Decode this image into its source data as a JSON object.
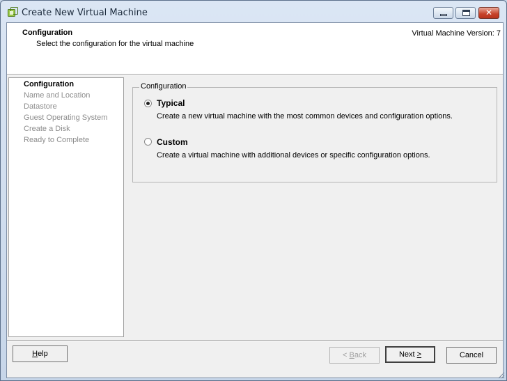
{
  "window": {
    "title": "Create New Virtual Machine",
    "app_icon": "vsphere-vm-icon",
    "controls": {
      "minimize": "minimize-icon",
      "maximize": "maximize-icon",
      "close": "close-icon"
    },
    "close_glyph": "✕"
  },
  "header": {
    "title": "Configuration",
    "subtitle": "Select the configuration for the virtual machine",
    "version": "Virtual Machine Version: 7"
  },
  "nav": {
    "items": [
      {
        "label": "Configuration",
        "active": true
      },
      {
        "label": "Name and Location",
        "active": false
      },
      {
        "label": "Datastore",
        "active": false
      },
      {
        "label": "Guest Operating System",
        "active": false
      },
      {
        "label": "Create a Disk",
        "active": false
      },
      {
        "label": "Ready to Complete",
        "active": false
      }
    ]
  },
  "configuration": {
    "legend": "Configuration",
    "selected": "Typical",
    "options": [
      {
        "label": "Typical",
        "description": "Create a new virtual machine with the most common devices and configuration options."
      },
      {
        "label": "Custom",
        "description": "Create a virtual machine with additional devices or specific configuration options."
      }
    ]
  },
  "buttons": {
    "help": {
      "mnemonic": "H",
      "rest": "elp"
    },
    "back": {
      "prefix": "< ",
      "mnemonic": "B",
      "rest": "ack"
    },
    "next": {
      "label": "Next ",
      "mnemonic": ">"
    },
    "cancel": "Cancel"
  },
  "colors": {
    "accent": "#5b6f8a",
    "titlebar": "#dbe6f4",
    "close_button": "#c7432b",
    "disabled_text": "#8c8c8c"
  }
}
